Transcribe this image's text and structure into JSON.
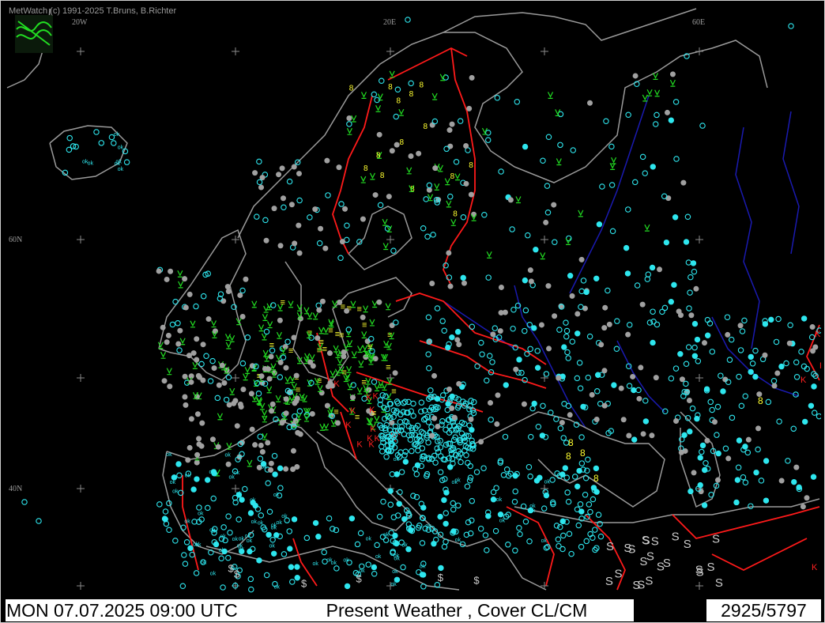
{
  "app": {
    "copyright": "MetWatch  (c) 1991-2025 T.Bruns, B.Richter"
  },
  "map": {
    "projection": "polar-stereographic",
    "coordinate_labels": {
      "lon_20w": "20W",
      "lon_20e": "20E",
      "lon_60e": "60E",
      "lat_60n": "60N",
      "lat_40n": "40N"
    },
    "colors": {
      "background": "#000000",
      "coastline": "#9a9a9a",
      "country_border": "#ff1a1a",
      "river": "#1a1ab0",
      "station_cyan": "#2ee6ee",
      "station_gray": "#a0a0a0",
      "weather_green": "#22dd22",
      "weather_yellow": "#ffff30",
      "weather_red": "#ff2020",
      "weather_white": "#cccccc"
    },
    "station_text": {
      "ok": "ok",
      "haze": "∞",
      "smoke": "S",
      "dust": "$"
    }
  },
  "status_bar": {
    "datetime": "MON 07.07.2025 09:00 UTC",
    "product": "Present Weather    , Cover CL/CM",
    "count": "2925/5797"
  }
}
